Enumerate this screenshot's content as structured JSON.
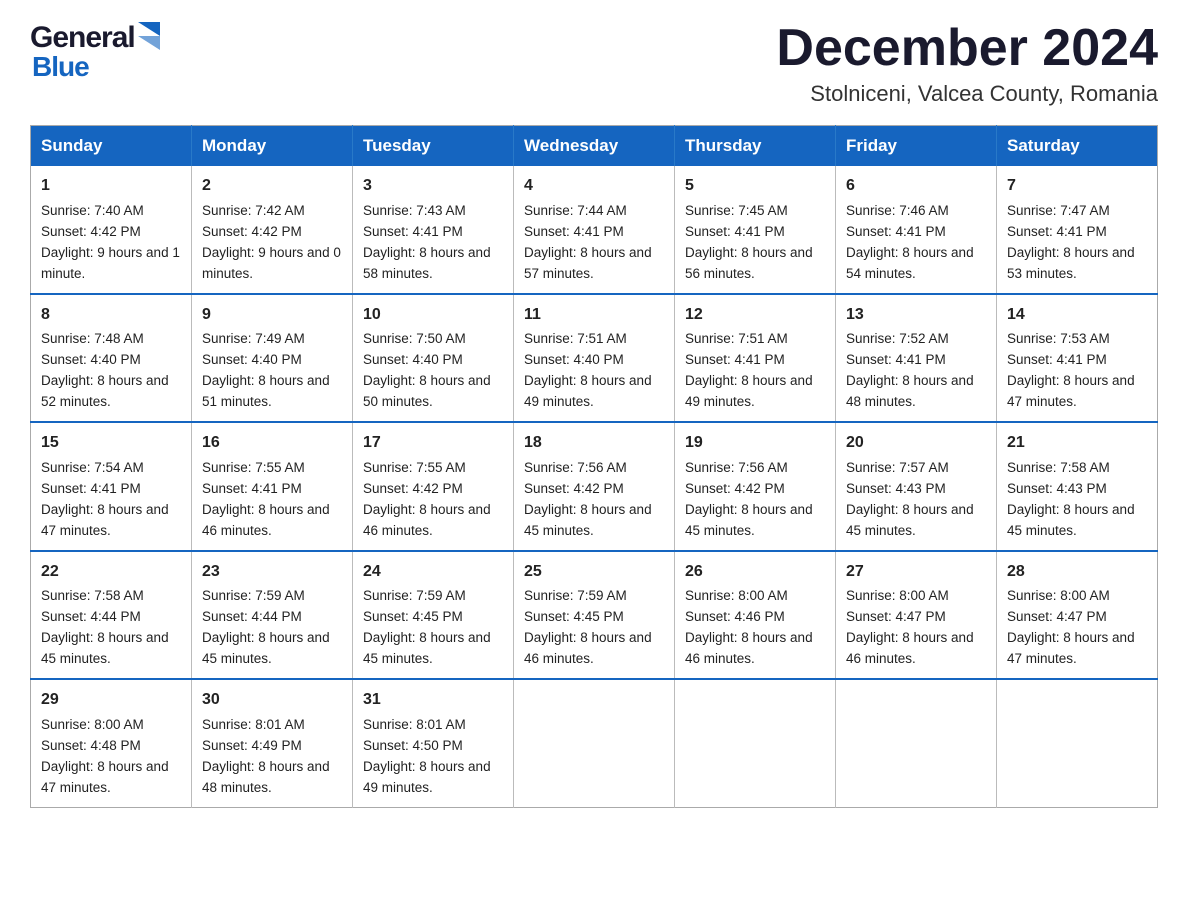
{
  "header": {
    "logo_general": "General",
    "logo_blue": "Blue",
    "month_title": "December 2024",
    "location": "Stolniceni, Valcea County, Romania"
  },
  "days_of_week": [
    "Sunday",
    "Monday",
    "Tuesday",
    "Wednesday",
    "Thursday",
    "Friday",
    "Saturday"
  ],
  "weeks": [
    [
      {
        "num": "1",
        "sunrise": "7:40 AM",
        "sunset": "4:42 PM",
        "daylight": "9 hours and 1 minute."
      },
      {
        "num": "2",
        "sunrise": "7:42 AM",
        "sunset": "4:42 PM",
        "daylight": "9 hours and 0 minutes."
      },
      {
        "num": "3",
        "sunrise": "7:43 AM",
        "sunset": "4:41 PM",
        "daylight": "8 hours and 58 minutes."
      },
      {
        "num": "4",
        "sunrise": "7:44 AM",
        "sunset": "4:41 PM",
        "daylight": "8 hours and 57 minutes."
      },
      {
        "num": "5",
        "sunrise": "7:45 AM",
        "sunset": "4:41 PM",
        "daylight": "8 hours and 56 minutes."
      },
      {
        "num": "6",
        "sunrise": "7:46 AM",
        "sunset": "4:41 PM",
        "daylight": "8 hours and 54 minutes."
      },
      {
        "num": "7",
        "sunrise": "7:47 AM",
        "sunset": "4:41 PM",
        "daylight": "8 hours and 53 minutes."
      }
    ],
    [
      {
        "num": "8",
        "sunrise": "7:48 AM",
        "sunset": "4:40 PM",
        "daylight": "8 hours and 52 minutes."
      },
      {
        "num": "9",
        "sunrise": "7:49 AM",
        "sunset": "4:40 PM",
        "daylight": "8 hours and 51 minutes."
      },
      {
        "num": "10",
        "sunrise": "7:50 AM",
        "sunset": "4:40 PM",
        "daylight": "8 hours and 50 minutes."
      },
      {
        "num": "11",
        "sunrise": "7:51 AM",
        "sunset": "4:40 PM",
        "daylight": "8 hours and 49 minutes."
      },
      {
        "num": "12",
        "sunrise": "7:51 AM",
        "sunset": "4:41 PM",
        "daylight": "8 hours and 49 minutes."
      },
      {
        "num": "13",
        "sunrise": "7:52 AM",
        "sunset": "4:41 PM",
        "daylight": "8 hours and 48 minutes."
      },
      {
        "num": "14",
        "sunrise": "7:53 AM",
        "sunset": "4:41 PM",
        "daylight": "8 hours and 47 minutes."
      }
    ],
    [
      {
        "num": "15",
        "sunrise": "7:54 AM",
        "sunset": "4:41 PM",
        "daylight": "8 hours and 47 minutes."
      },
      {
        "num": "16",
        "sunrise": "7:55 AM",
        "sunset": "4:41 PM",
        "daylight": "8 hours and 46 minutes."
      },
      {
        "num": "17",
        "sunrise": "7:55 AM",
        "sunset": "4:42 PM",
        "daylight": "8 hours and 46 minutes."
      },
      {
        "num": "18",
        "sunrise": "7:56 AM",
        "sunset": "4:42 PM",
        "daylight": "8 hours and 45 minutes."
      },
      {
        "num": "19",
        "sunrise": "7:56 AM",
        "sunset": "4:42 PM",
        "daylight": "8 hours and 45 minutes."
      },
      {
        "num": "20",
        "sunrise": "7:57 AM",
        "sunset": "4:43 PM",
        "daylight": "8 hours and 45 minutes."
      },
      {
        "num": "21",
        "sunrise": "7:58 AM",
        "sunset": "4:43 PM",
        "daylight": "8 hours and 45 minutes."
      }
    ],
    [
      {
        "num": "22",
        "sunrise": "7:58 AM",
        "sunset": "4:44 PM",
        "daylight": "8 hours and 45 minutes."
      },
      {
        "num": "23",
        "sunrise": "7:59 AM",
        "sunset": "4:44 PM",
        "daylight": "8 hours and 45 minutes."
      },
      {
        "num": "24",
        "sunrise": "7:59 AM",
        "sunset": "4:45 PM",
        "daylight": "8 hours and 45 minutes."
      },
      {
        "num": "25",
        "sunrise": "7:59 AM",
        "sunset": "4:45 PM",
        "daylight": "8 hours and 46 minutes."
      },
      {
        "num": "26",
        "sunrise": "8:00 AM",
        "sunset": "4:46 PM",
        "daylight": "8 hours and 46 minutes."
      },
      {
        "num": "27",
        "sunrise": "8:00 AM",
        "sunset": "4:47 PM",
        "daylight": "8 hours and 46 minutes."
      },
      {
        "num": "28",
        "sunrise": "8:00 AM",
        "sunset": "4:47 PM",
        "daylight": "8 hours and 47 minutes."
      }
    ],
    [
      {
        "num": "29",
        "sunrise": "8:00 AM",
        "sunset": "4:48 PM",
        "daylight": "8 hours and 47 minutes."
      },
      {
        "num": "30",
        "sunrise": "8:01 AM",
        "sunset": "4:49 PM",
        "daylight": "8 hours and 48 minutes."
      },
      {
        "num": "31",
        "sunrise": "8:01 AM",
        "sunset": "4:50 PM",
        "daylight": "8 hours and 49 minutes."
      },
      null,
      null,
      null,
      null
    ]
  ]
}
